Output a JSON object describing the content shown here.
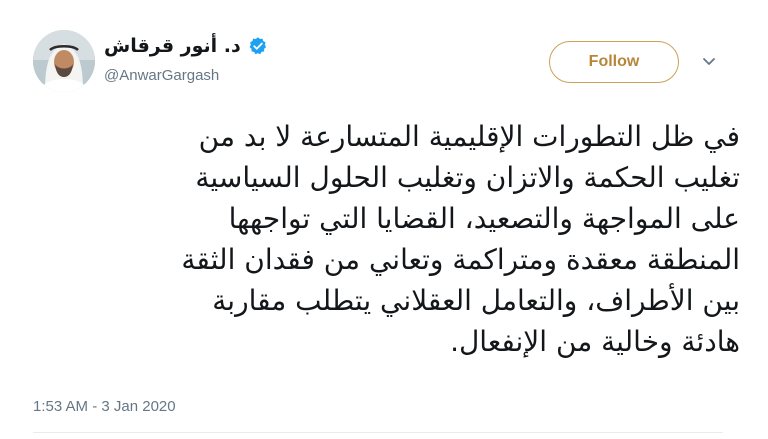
{
  "tweet": {
    "author": {
      "display_name": "د. أنور قرقاش",
      "handle": "@AnwarGargash",
      "verified_icon": "verified-badge-icon",
      "avatar_icon": "profile-photo"
    },
    "follow_label": "Follow",
    "menu_icon": "chevron-down-icon",
    "text_lines": [
      "في ظل التطورات الإقليمية المتسارعة لا بد من",
      "تغليب الحكمة والاتزان وتغليب الحلول السياسية",
      "على المواجهة والتصعيد، القضايا التي تواجهها",
      "المنطقة معقدة ومتراكمة وتعاني من فقدان الثقة",
      "بين الأطراف، والتعامل العقلاني يتطلب مقاربة",
      "هادئة وخالية من الإنفعال."
    ],
    "timestamp": "1:53 AM - 3 Jan 2020"
  },
  "colors": {
    "follow_accent": "#b7863a",
    "verified_blue": "#1da1f2",
    "secondary_text": "#657786",
    "primary_text": "#14171a"
  }
}
